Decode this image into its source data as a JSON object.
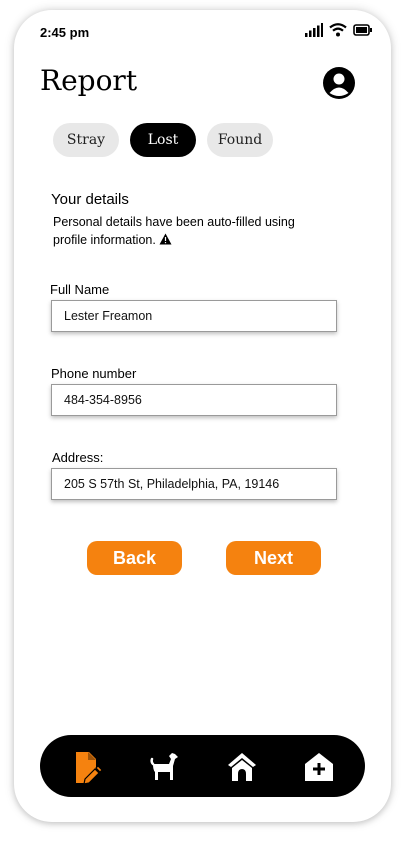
{
  "status_bar": {
    "time": "2:45 pm"
  },
  "header": {
    "title": "Report",
    "profile_icon": "user-circle-icon"
  },
  "tabs": [
    {
      "label": "Stray",
      "active": false
    },
    {
      "label": "Lost",
      "active": true
    },
    {
      "label": "Found",
      "active": false
    }
  ],
  "details": {
    "title": "Your details",
    "description": "Personal details have been auto-filled using profile information."
  },
  "form": {
    "full_name": {
      "label": "Full Name",
      "value": "Lester Freamon"
    },
    "phone": {
      "label": "Phone number",
      "value": "484-354-8956"
    },
    "address": {
      "label": "Address:",
      "value": "205 S 57th St, Philadelphia, PA, 19146"
    }
  },
  "buttons": {
    "back": "Back",
    "next": "Next"
  },
  "bottom_nav": [
    {
      "icon": "report-edit-icon",
      "active": true
    },
    {
      "icon": "dog-icon",
      "active": false
    },
    {
      "icon": "shelter-home-icon",
      "active": false
    },
    {
      "icon": "add-home-icon",
      "active": false
    }
  ],
  "colors": {
    "accent": "#f5820f",
    "nav_bg": "#000000",
    "tab_bg": "#e8e8e8"
  }
}
